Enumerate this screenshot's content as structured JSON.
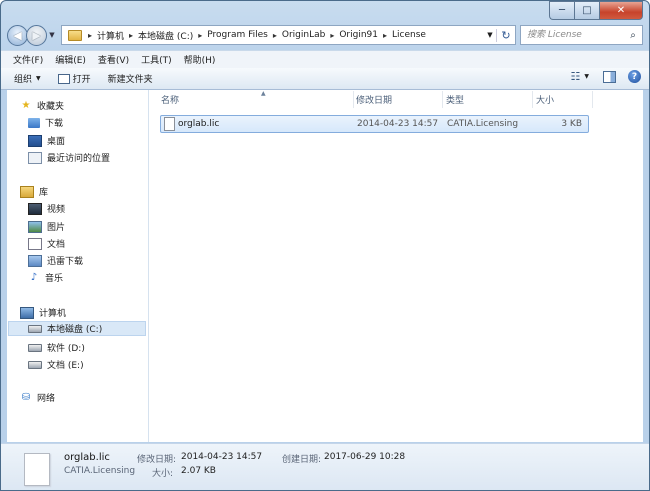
{
  "window": {
    "caption_buttons": {
      "minimize": "─",
      "maximize": "□",
      "close": "✕"
    }
  },
  "nav": {
    "back_icon": "back-arrow-icon",
    "forward_icon": "forward-arrow-icon",
    "address": {
      "leading_arrow": "▸",
      "crumbs": [
        "计算机",
        "本地磁盘 (C:)",
        "Program Files",
        "OriginLab",
        "Origin91",
        "License"
      ],
      "separator": "▸"
    },
    "search": {
      "placeholder": "搜索 License"
    }
  },
  "menubar": {
    "items": [
      "文件(F)",
      "编辑(E)",
      "查看(V)",
      "工具(T)",
      "帮助(H)"
    ]
  },
  "toolbar": {
    "organize": "组织",
    "open": "打开",
    "new_folder": "新建文件夹"
  },
  "sidebar": {
    "favorites": {
      "label": "收藏夹",
      "items": [
        "下载",
        "桌面",
        "最近访问的位置"
      ]
    },
    "libraries": {
      "label": "库",
      "items": [
        "视频",
        "图片",
        "文档",
        "迅雷下载",
        "音乐"
      ]
    },
    "computer": {
      "label": "计算机",
      "items": [
        "本地磁盘 (C:)",
        "软件 (D:)",
        "文档 (E:)"
      ]
    },
    "network": {
      "label": "网络"
    }
  },
  "columns": {
    "name": "名称",
    "modified": "修改日期",
    "type": "类型",
    "size": "大小",
    "sort_indicator": "▲"
  },
  "files": [
    {
      "name": "orglab.lic",
      "modified": "2014-04-23 14:57",
      "type": "CATIA.Licensing",
      "size": "3 KB",
      "selected": true
    }
  ],
  "details": {
    "name": "orglab.lic",
    "type": "CATIA.Licensing",
    "modified_label": "修改日期:",
    "modified_value": "2014-04-23 14:57",
    "size_label": "大小:",
    "size_value": "2.07 KB",
    "created_label": "创建日期:",
    "created_value": "2017-06-29 10:28"
  }
}
